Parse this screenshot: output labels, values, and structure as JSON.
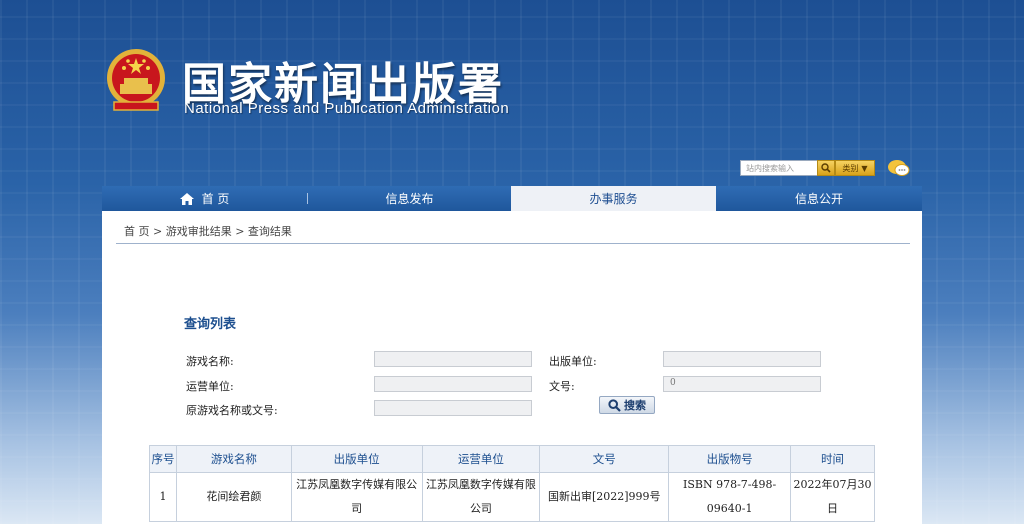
{
  "header": {
    "title_cn": "国家新闻出版署",
    "title_en": "National  Press and Publication Administration",
    "search_placeholder": "站内搜索输入",
    "category_label": "类别"
  },
  "nav": {
    "items": [
      {
        "label": "首 页"
      },
      {
        "label": "信息发布"
      },
      {
        "label": "办事服务"
      },
      {
        "label": "信息公开"
      }
    ]
  },
  "breadcrumb": "首 页 > 游戏审批结果 > 查询结果",
  "form": {
    "title": "查询列表",
    "game_name_label": "游戏名称:",
    "publisher_label": "出版单位:",
    "operator_label": "运营单位:",
    "doc_no_label": "文号:",
    "doc_no_value": "0",
    "orig_label": "原游戏名称或文号:",
    "search_label": "搜索"
  },
  "table": {
    "headers": [
      "序号",
      "游戏名称",
      "出版单位",
      "运营单位",
      "文号",
      "出版物号",
      "时间"
    ],
    "rows": [
      {
        "index": "1",
        "name": "花间绘君颜",
        "publisher": "江苏凤凰数字传媒有限公司",
        "operator": "江苏凤凰数字传媒有限公司",
        "doc_no": "国新出审[2022]999号",
        "isbn": "ISBN 978-7-498-09640-1",
        "date": "2022年07月30日"
      }
    ]
  },
  "colors": {
    "brand_blue": "#1d4f8f",
    "nav_blue": "#2f6cb4",
    "accent_gold": "#d9a21a"
  }
}
